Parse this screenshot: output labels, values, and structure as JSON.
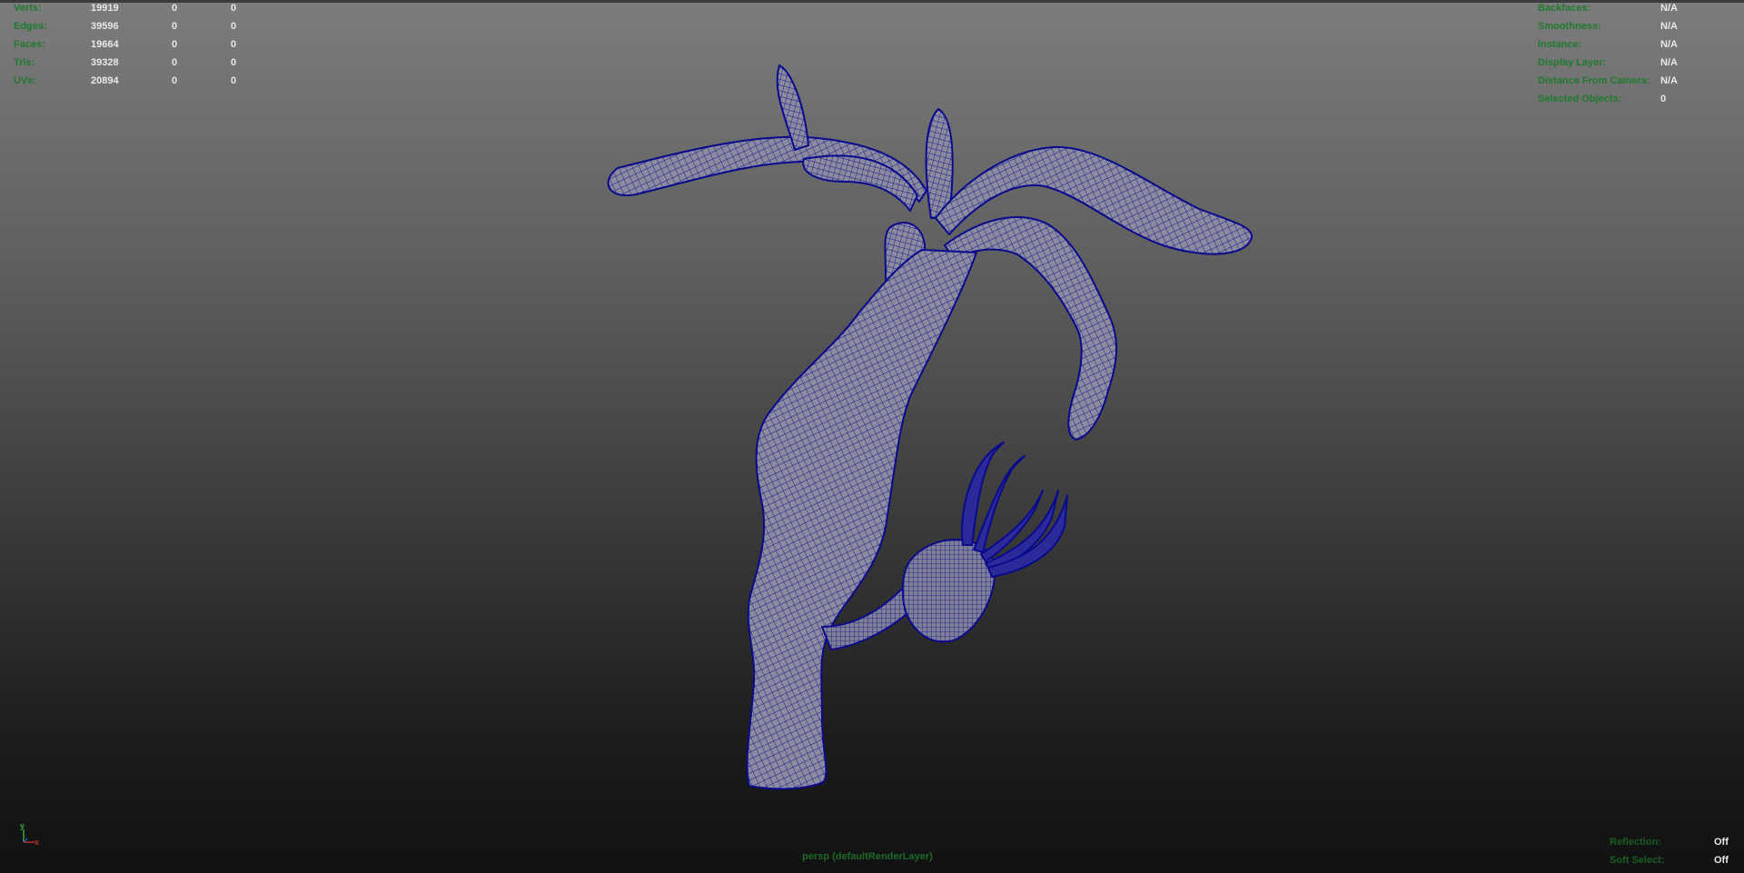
{
  "hud_left": {
    "rows": [
      {
        "label": "Verts:",
        "v1": "19919",
        "v2": "0",
        "v3": "0"
      },
      {
        "label": "Edges:",
        "v1": "39596",
        "v2": "0",
        "v3": "0"
      },
      {
        "label": "Faces:",
        "v1": "19664",
        "v2": "0",
        "v3": "0"
      },
      {
        "label": "Tris:",
        "v1": "39328",
        "v2": "0",
        "v3": "0"
      },
      {
        "label": "UVs:",
        "v1": "20894",
        "v2": "0",
        "v3": "0"
      }
    ]
  },
  "hud_right": {
    "rows": [
      {
        "label": "Backfaces:",
        "value": "N/A"
      },
      {
        "label": "Smoothness:",
        "value": "N/A"
      },
      {
        "label": "Instance:",
        "value": "N/A"
      },
      {
        "label": "Display Layer:",
        "value": "N/A"
      },
      {
        "label": "Distance From Camera:",
        "value": "N/A"
      },
      {
        "label": "Selected Objects:",
        "value": "0"
      }
    ]
  },
  "hud_bottom": {
    "rows": [
      {
        "label": "Reflection:",
        "value": "Off"
      },
      {
        "label": "Soft Select:",
        "value": "Off"
      }
    ]
  },
  "viewport": {
    "camera_label": "persp (defaultRenderLayer)",
    "axis_y": "y",
    "axis_x": "x"
  },
  "colors": {
    "wire": "#0a0a8c",
    "shade": "#8a8a9c",
    "label_green": "#1f7a2e",
    "value_white": "#e8e8e8"
  },
  "icons": [
    "axis-gizmo-icon"
  ]
}
